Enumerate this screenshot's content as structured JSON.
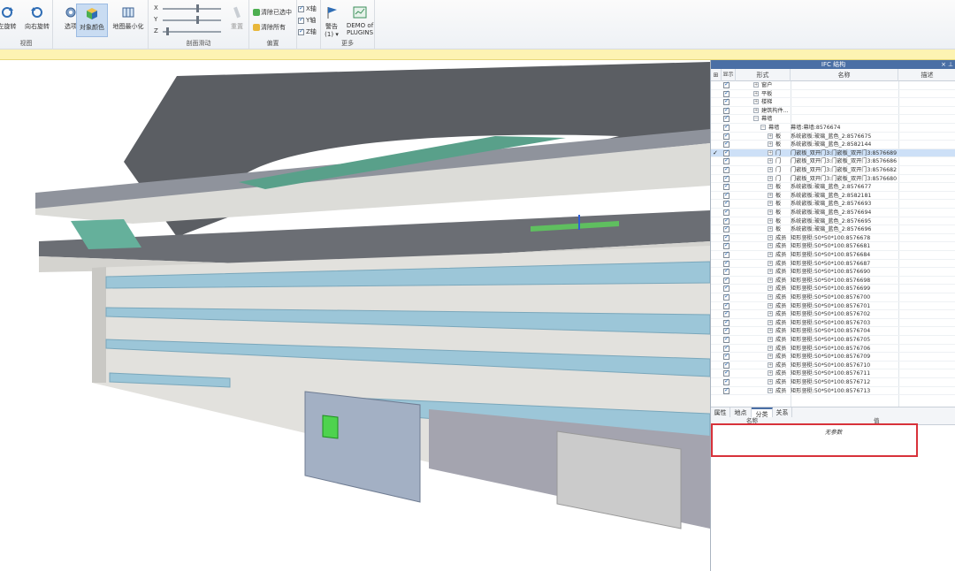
{
  "ribbon": {
    "groups": {
      "view": "视图",
      "clip": "剖面滑动",
      "offset": "偏置",
      "more": "更多"
    },
    "buttons": {
      "rotate": "左旋转",
      "rotate_self": "向右旋转",
      "options": "选项",
      "object_color": "对象颜色",
      "map_minimize": "地图最小化",
      "reset": "重置",
      "clear_selected": "清除已选中",
      "clear_all": "清除所有",
      "alert": "警告",
      "alert_count": "(1) ▾",
      "demo_line1": "DEMO of",
      "demo_line2": "PLUGINS"
    },
    "sliders": [
      "X",
      "Y",
      "Z"
    ],
    "axes": [
      "X轴",
      "Y轴",
      "Z轴"
    ]
  },
  "colors": {
    "accent": "#4a6fa5",
    "selection": "#cde0f7",
    "highlight_box": "#d8323a",
    "warning_bar": "#fdf3b2",
    "glass": "#9cc6d8",
    "selected_element": "#4ed34e"
  },
  "panel": {
    "title": "IFC 结构",
    "columns": {
      "visible": "显示",
      "type": "形式",
      "name": "名称",
      "desc": "描述"
    },
    "tree": [
      {
        "type": "窗户",
        "name": "",
        "indent": 1,
        "expand": "+"
      },
      {
        "type": "平板",
        "name": "",
        "indent": 1,
        "expand": "+"
      },
      {
        "type": "楼梯",
        "name": "",
        "indent": 1,
        "expand": "+"
      },
      {
        "type": "建筑构件...",
        "name": "",
        "indent": 1,
        "expand": "+"
      },
      {
        "type": "幕墙",
        "name": "",
        "indent": 1,
        "expand": "−"
      },
      {
        "type": "幕墙",
        "name": "幕墙:幕墙:8576674",
        "indent": 2,
        "expand": "−"
      },
      {
        "type": "板",
        "name": "系统嵌板:玻璃_蓝色_2:8576675",
        "indent": 3,
        "expand": "+"
      },
      {
        "type": "板",
        "name": "系统嵌板:玻璃_蓝色_2:8582144",
        "indent": 3,
        "expand": "+"
      },
      {
        "type": "门",
        "name": "门嵌板_双开门3:门嵌板_双开门3:8576689",
        "indent": 3,
        "expand": "+",
        "selected": true
      },
      {
        "type": "门",
        "name": "门嵌板_双开门3:门嵌板_双开门3:8576686",
        "indent": 3,
        "expand": "+"
      },
      {
        "type": "门",
        "name": "门嵌板_双开门3:门嵌板_双开门3:8576682",
        "indent": 3,
        "expand": "+"
      },
      {
        "type": "门",
        "name": "门嵌板_双开门3:门嵌板_双开门3:8576680",
        "indent": 3,
        "expand": "+"
      },
      {
        "type": "板",
        "name": "系统嵌板:玻璃_蓝色_2:8576677",
        "indent": 3,
        "expand": "+"
      },
      {
        "type": "板",
        "name": "系统嵌板:玻璃_蓝色_2:8582181",
        "indent": 3,
        "expand": "+"
      },
      {
        "type": "板",
        "name": "系统嵌板:玻璃_蓝色_2:8576693",
        "indent": 3,
        "expand": "+"
      },
      {
        "type": "板",
        "name": "系统嵌板:玻璃_蓝色_2:8576694",
        "indent": 3,
        "expand": "+"
      },
      {
        "type": "板",
        "name": "系统嵌板:玻璃_蓝色_2:8576695",
        "indent": 3,
        "expand": "+"
      },
      {
        "type": "板",
        "name": "系统嵌板:玻璃_蓝色_2:8576696",
        "indent": 3,
        "expand": "+"
      },
      {
        "type": "成员",
        "name": "矩形竖梃:50*50*100:8576678",
        "indent": 3,
        "expand": "+"
      },
      {
        "type": "成员",
        "name": "矩形竖梃:50*50*100:8576681",
        "indent": 3,
        "expand": "+"
      },
      {
        "type": "成员",
        "name": "矩形竖梃:50*50*100:8576684",
        "indent": 3,
        "expand": "+"
      },
      {
        "type": "成员",
        "name": "矩形竖梃:50*50*100:8576687",
        "indent": 3,
        "expand": "+"
      },
      {
        "type": "成员",
        "name": "矩形竖梃:50*50*100:8576690",
        "indent": 3,
        "expand": "+"
      },
      {
        "type": "成员",
        "name": "矩形竖梃:50*50*100:8576698",
        "indent": 3,
        "expand": "+"
      },
      {
        "type": "成员",
        "name": "矩形竖梃:50*50*100:8576699",
        "indent": 3,
        "expand": "+"
      },
      {
        "type": "成员",
        "name": "矩形竖梃:50*50*100:8576700",
        "indent": 3,
        "expand": "+"
      },
      {
        "type": "成员",
        "name": "矩形竖梃:50*50*100:8576701",
        "indent": 3,
        "expand": "+"
      },
      {
        "type": "成员",
        "name": "矩形竖梃:50*50*100:8576702",
        "indent": 3,
        "expand": "+"
      },
      {
        "type": "成员",
        "name": "矩形竖梃:50*50*100:8576703",
        "indent": 3,
        "expand": "+"
      },
      {
        "type": "成员",
        "name": "矩形竖梃:50*50*100:8576704",
        "indent": 3,
        "expand": "+"
      },
      {
        "type": "成员",
        "name": "矩形竖梃:50*50*100:8576705",
        "indent": 3,
        "expand": "+"
      },
      {
        "type": "成员",
        "name": "矩形竖梃:50*50*100:8576706",
        "indent": 3,
        "expand": "+"
      },
      {
        "type": "成员",
        "name": "矩形竖梃:50*50*100:8576709",
        "indent": 3,
        "expand": "+"
      },
      {
        "type": "成员",
        "name": "矩形竖梃:50*50*100:8576710",
        "indent": 3,
        "expand": "+"
      },
      {
        "type": "成员",
        "name": "矩形竖梃:50*50*100:8576711",
        "indent": 3,
        "expand": "+"
      },
      {
        "type": "成员",
        "name": "矩形竖梃:50*50*100:8576712",
        "indent": 3,
        "expand": "+"
      },
      {
        "type": "成员",
        "name": "矩形竖梃:50*50*100:8576713",
        "indent": 3,
        "expand": "+"
      }
    ],
    "tabs": [
      "属性",
      "地点",
      "分类",
      "关系"
    ],
    "active_tab": 2,
    "props": {
      "col_name": "名称",
      "col_value": "值",
      "empty": "无参数"
    }
  }
}
